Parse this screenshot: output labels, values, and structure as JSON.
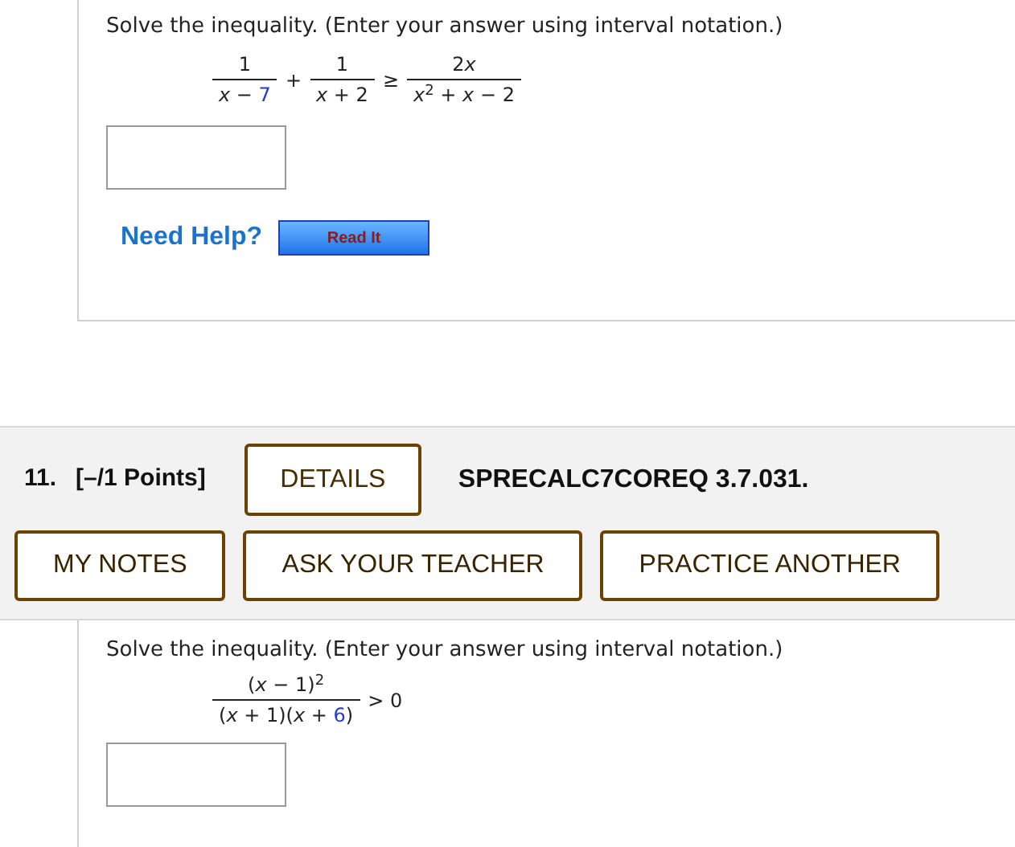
{
  "problem_top": {
    "instruction": "Solve the inequality. (Enter your answer using interval notation.)",
    "expression": [
      {
        "kind": "fraction",
        "numerator": [
          {
            "text": "1",
            "highlighted": false
          }
        ],
        "denominator": [
          {
            "text": "*x* − ",
            "highlighted": false
          },
          {
            "text": "7",
            "highlighted": true
          }
        ]
      },
      {
        "kind": "operator",
        "text": "+"
      },
      {
        "kind": "fraction",
        "numerator": [
          {
            "text": "1",
            "highlighted": false
          }
        ],
        "denominator": [
          {
            "text": "*x* + 2",
            "highlighted": false
          }
        ]
      },
      {
        "kind": "operator",
        "text": "≥"
      },
      {
        "kind": "fraction",
        "numerator": [
          {
            "text": "2",
            "highlighted": false
          },
          {
            "text": "*x*",
            "highlighted": false
          }
        ],
        "denominator": [
          {
            "text": "*x*$^{2}$ + *x* − 2",
            "highlighted": false
          }
        ]
      }
    ],
    "help": {
      "label": "Need Help?",
      "button": "Read It"
    }
  },
  "question": {
    "number": "11.",
    "points": "[–/1 Points]",
    "details_button": "DETAILS",
    "code": "SPRECALC7COREQ 3.7.031.",
    "buttons": [
      "MY NOTES",
      "ASK YOUR TEACHER",
      "PRACTICE ANOTHER"
    ],
    "instruction": "Solve the inequality. (Enter your answer using interval notation.)",
    "expression": [
      {
        "kind": "fraction",
        "numerator": [
          {
            "text": "(*x* − 1)$^{2}$",
            "highlighted": false
          }
        ],
        "denominator": [
          {
            "text": "(*x* + 1)(*x* + ",
            "highlighted": false
          },
          {
            "text": "6",
            "highlighted": true
          },
          {
            "text": ")",
            "highlighted": false
          }
        ]
      },
      {
        "kind": "operator",
        "text": "> 0"
      }
    ]
  }
}
